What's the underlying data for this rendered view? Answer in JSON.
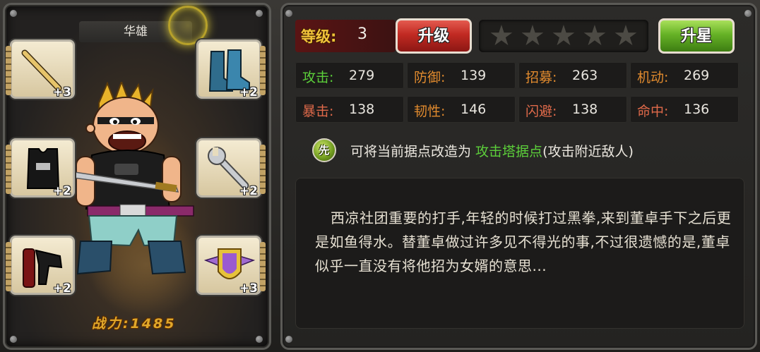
{
  "hero": {
    "name": "华雄",
    "power_label": "战力:1485"
  },
  "equipment": [
    {
      "slot": "weapon",
      "icon": "bat-icon",
      "plus": "+3"
    },
    {
      "slot": "boots",
      "icon": "boots-icon",
      "plus": "+2"
    },
    {
      "slot": "armor",
      "icon": "vest-icon",
      "plus": "+2"
    },
    {
      "slot": "tool",
      "icon": "wrench-icon",
      "plus": "+2"
    },
    {
      "slot": "item",
      "icon": "hairdryer-icon",
      "plus": "+2"
    },
    {
      "slot": "badge",
      "icon": "badge-icon",
      "plus": "+3"
    }
  ],
  "level": {
    "label": "等级:",
    "value": "3",
    "upgrade_button": "升级"
  },
  "stars": {
    "filled": 0,
    "total": 5,
    "upgrade_button": "升星"
  },
  "stats": [
    {
      "label": "攻击:",
      "value": "279",
      "color": "green"
    },
    {
      "label": "防御:",
      "value": "139",
      "color": "orange"
    },
    {
      "label": "招募:",
      "value": "263",
      "color": "orange"
    },
    {
      "label": "机动:",
      "value": "269",
      "color": "orange"
    },
    {
      "label": "暴击:",
      "value": "138",
      "color": "red"
    },
    {
      "label": "韧性:",
      "value": "146",
      "color": "orange"
    },
    {
      "label": "闪避:",
      "value": "138",
      "color": "red"
    },
    {
      "label": "命中:",
      "value": "136",
      "color": "red"
    }
  ],
  "skill": {
    "icon_char": "先",
    "prefix": "可将当前据点改造为 ",
    "highlight": "攻击塔据点",
    "suffix": "(攻击附近敌人)"
  },
  "description": "西凉社团重要的打手,年轻的时候打过黑拳,来到董卓手下之后更是如鱼得水。替董卓做过许多见不得光的事,不过很遗憾的是,董卓似乎一直没有将他招为女婿的意思...",
  "colors": {
    "level_label": "#f0c33a",
    "stat_green": "#5ccf3a",
    "stat_orange": "#e08a2e",
    "stat_red": "#e06a4a",
    "highlight_green": "#5ccf3a",
    "power_gold": "#e0a72a"
  }
}
